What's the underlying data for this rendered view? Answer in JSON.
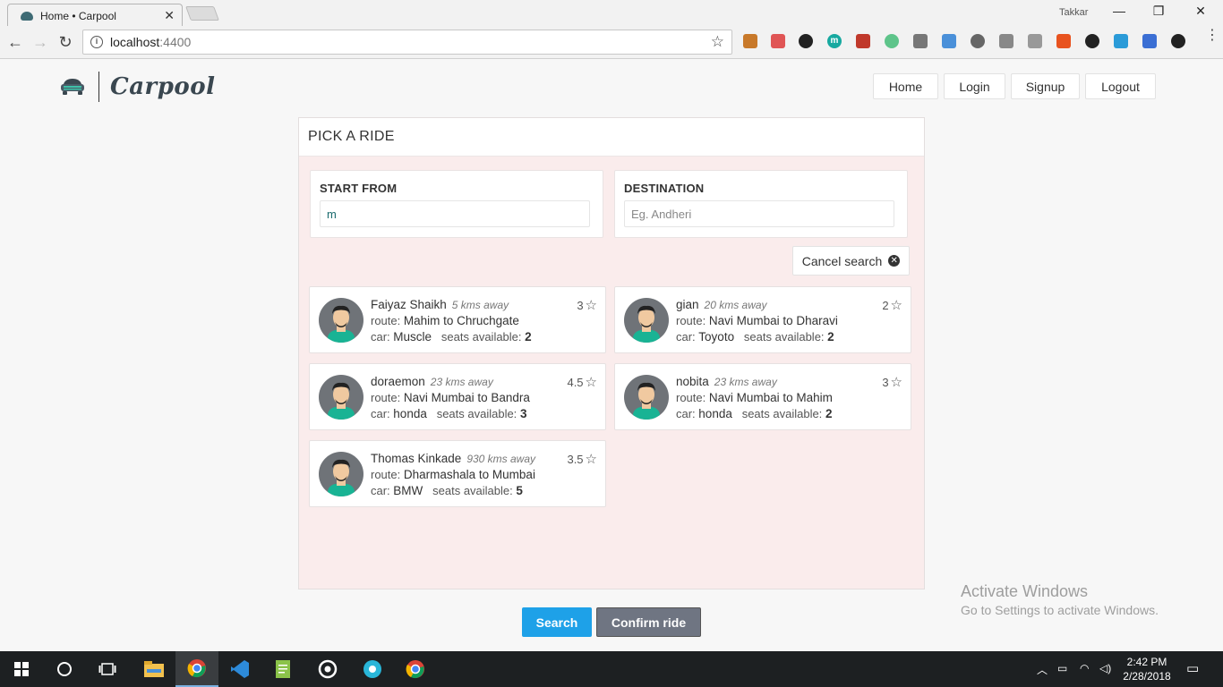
{
  "browser": {
    "tab_title": "Home • Carpool",
    "url_host": "localhost",
    "url_port": ":4400",
    "profile_name": "Takkar"
  },
  "header": {
    "logo_text": "Carpool",
    "nav": [
      "Home",
      "Login",
      "Signup",
      "Logout"
    ]
  },
  "panel": {
    "title": "PICK A RIDE",
    "start_from": {
      "label": "START FROM",
      "value": "m",
      "placeholder": ""
    },
    "destination": {
      "label": "DESTINATION",
      "value": "",
      "placeholder": "Eg. Andheri"
    },
    "cancel_label": "Cancel search",
    "labels": {
      "route": "route:",
      "car": "car:",
      "seats": "seats available:"
    },
    "rides": [
      {
        "name": "Faiyaz Shaikh",
        "distance": "5 kms away",
        "rating": "3",
        "route": "Mahim to Chruchgate",
        "car": "Muscle",
        "seats": "2"
      },
      {
        "name": "gian",
        "distance": "20 kms away",
        "rating": "2",
        "route": "Navi Mumbai to Dharavi",
        "car": "Toyoto",
        "seats": "2"
      },
      {
        "name": "doraemon",
        "distance": "23 kms away",
        "rating": "4.5",
        "route": "Navi Mumbai to Bandra",
        "car": "honda",
        "seats": "3"
      },
      {
        "name": "nobita",
        "distance": "23 kms away",
        "rating": "3",
        "route": "Navi Mumbai to Mahim",
        "car": "honda",
        "seats": "2"
      },
      {
        "name": "Thomas Kinkade",
        "distance": "930 kms away",
        "rating": "3.5",
        "route": "Dharmashala to Mumbai",
        "car": "BMW",
        "seats": "5"
      }
    ]
  },
  "actions": {
    "search": "Search",
    "confirm": "Confirm ride"
  },
  "watermark": {
    "title": "Activate Windows",
    "subtitle": "Go to Settings to activate Windows."
  },
  "taskbar": {
    "time": "2:42 PM",
    "date": "2/28/2018"
  },
  "colors": {
    "primary": "#1ea1e8",
    "secondary": "#6f7582",
    "panel_bg": "#faecec",
    "avatar_shirt": "#19b394"
  }
}
